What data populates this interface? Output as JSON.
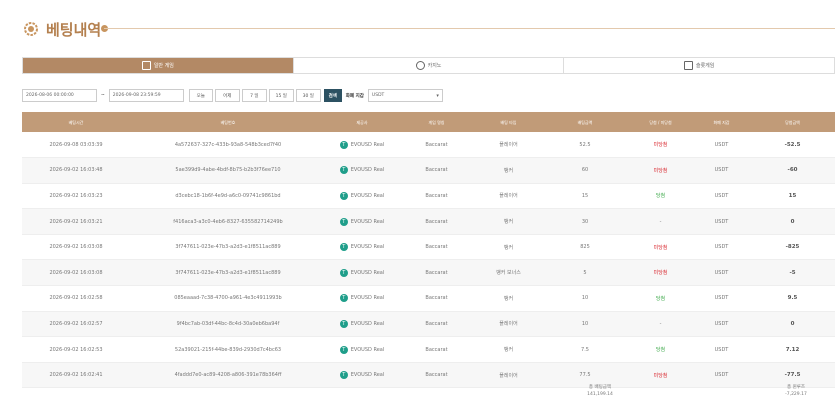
{
  "page": {
    "title": "베팅내역"
  },
  "tabs": [
    {
      "label": "일반 게임",
      "active": true
    },
    {
      "label": "카지노",
      "active": false
    },
    {
      "label": "슬롯게임",
      "active": false
    }
  ],
  "filters": {
    "start": "2026-08-06 00:00:00",
    "sep": "~",
    "end": "2026-09-08 23:59:59",
    "today": "오늘",
    "yesterday": "어제",
    "d7": "7 일",
    "d15": "15 일",
    "d30": "30 일",
    "search": "검색",
    "currency_label": "화폐 지갑",
    "currency_value": "USDT"
  },
  "table": {
    "headers": [
      "베팅시간",
      "베팅번호",
      "제공사",
      "게임 명칭",
      "배팅 타입",
      "배팅금액",
      "당첨 / 미당첨",
      "화폐 지갑",
      "당첨금액"
    ],
    "rows": [
      {
        "time": "2026-09-08 03:03:39",
        "id": "4a572637-327c-433b-93a8-548b3ced7f40",
        "provider": "EVOUSD Real",
        "game": "Baccarat",
        "type": "플레이어",
        "amount": "52.5",
        "result": "미당첨",
        "status": "lose",
        "wallet": "USDT",
        "win": "-52.5"
      },
      {
        "time": "2026-09-02 16:03:48",
        "id": "5ae399d9-4abe-4bdf-8b75-b2b3f76ee710",
        "provider": "EVOUSD Real",
        "game": "Baccarat",
        "type": "뱅커",
        "amount": "60",
        "result": "미당첨",
        "status": "lose",
        "wallet": "USDT",
        "win": "-60"
      },
      {
        "time": "2026-09-02 16:03:23",
        "id": "d3cebc18-1b6f-4e9d-a6c0-09741c9861bd",
        "provider": "EVOUSD Real",
        "game": "Baccarat",
        "type": "플레이어",
        "amount": "15",
        "result": "당첨",
        "status": "win",
        "wallet": "USDT",
        "win": "15"
      },
      {
        "time": "2026-09-02 16:03:21",
        "id": "f416aca3-a3c0-4eb6-8327-635582714249b",
        "provider": "EVOUSD Real",
        "game": "Baccarat",
        "type": "뱅커",
        "amount": "30",
        "result": "-",
        "status": "none",
        "wallet": "USDT",
        "win": "0"
      },
      {
        "time": "2026-09-02 16:03:08",
        "id": "3f747611-023e-47b3-a2d3-e1f8511ac889",
        "provider": "EVOUSD Real",
        "game": "Baccarat",
        "type": "뱅커",
        "amount": "825",
        "result": "미당첨",
        "status": "lose",
        "wallet": "USDT",
        "win": "-825"
      },
      {
        "time": "2026-09-02 16:03:08",
        "id": "3f747611-023e-47b3-a2d3-e1f8511ac889",
        "provider": "EVOUSD Real",
        "game": "Baccarat",
        "type": "뱅커 보너스",
        "amount": "5",
        "result": "미당첨",
        "status": "lose",
        "wallet": "USDT",
        "win": "-5"
      },
      {
        "time": "2026-09-02 16:02:58",
        "id": "085eaaad-7c38-4700-a961-4e3c4911993b",
        "provider": "EVOUSD Real",
        "game": "Baccarat",
        "type": "뱅커",
        "amount": "10",
        "result": "당첨",
        "status": "win",
        "wallet": "USDT",
        "win": "9.5"
      },
      {
        "time": "2026-09-02 16:02:57",
        "id": "9f4bc7ab-03df-44bc-8c4d-30a0eb6ba94f",
        "provider": "EVOUSD Real",
        "game": "Baccarat",
        "type": "플레이어",
        "amount": "10",
        "result": "-",
        "status": "none",
        "wallet": "USDT",
        "win": "0"
      },
      {
        "time": "2026-09-02 16:02:53",
        "id": "52a39021-215f-44be-839d-2930d7c4bc63",
        "provider": "EVOUSD Real",
        "game": "Baccarat",
        "type": "뱅커",
        "amount": "7.5",
        "result": "당첨",
        "status": "win",
        "wallet": "USDT",
        "win": "7.12"
      },
      {
        "time": "2026-09-02 16:02:41",
        "id": "4faddd7e0-ac89-4208-a806-391e78b364ff",
        "provider": "EVOUSD Real",
        "game": "Baccarat",
        "type": "플레이어",
        "amount": "77.5",
        "result": "미당첨",
        "status": "lose",
        "wallet": "USDT",
        "win": "-77.5"
      }
    ]
  },
  "footer": {
    "total_bet_label": "총 배팅금액",
    "total_bet_value": "141,199.14",
    "total_win_label": "총 윈루즈",
    "total_win_value": "-7,229.17"
  },
  "colors": {
    "accent": "#b38965",
    "header_bg": "#c19b78",
    "win": "#3aa847",
    "lose": "#d9272e",
    "search_btn": "#2c5162"
  }
}
